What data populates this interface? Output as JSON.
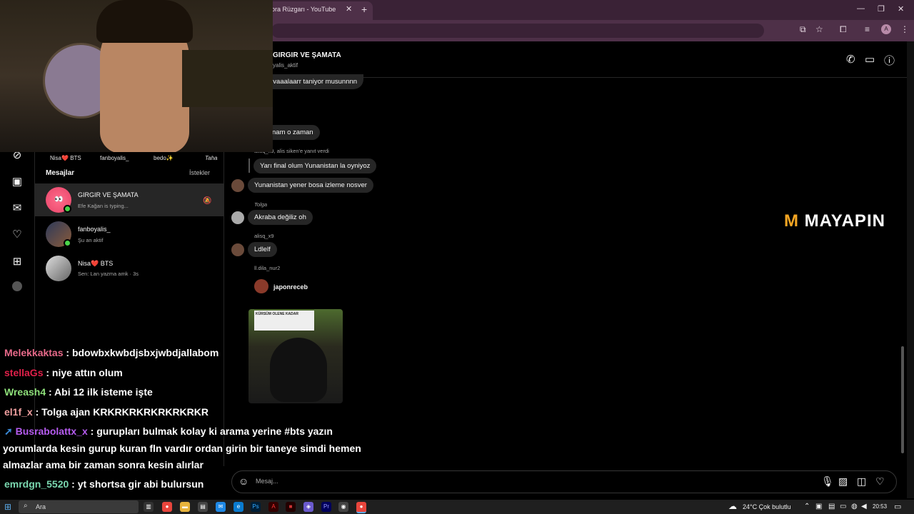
{
  "browser": {
    "tab_title": "ora Rüzgarı - YouTube",
    "tab_close": "✕",
    "new_tab": "+",
    "avatar_letter": "A"
  },
  "stories": [
    "Nisa❤️ BTS",
    "fanboyalis_",
    "bedo✨",
    "Taha"
  ],
  "dm": {
    "title": "Mesajlar",
    "requests": "İstekler",
    "conversations": [
      {
        "name": "GIRGIR VE ŞAMATA",
        "sub": "Efe Kağan is typing..."
      },
      {
        "name": "fanboyalis_",
        "sub": "Şu an aktif"
      },
      {
        "name": "Nisa❤️ BTS",
        "sub": "Sen: Lan yazma amk · 3s"
      }
    ]
  },
  "chat": {
    "title": "GIRGIR VE ŞAMATA",
    "subtitle": "yalis_aktif",
    "messages": [
      {
        "text": "ovaaalaarr taniyor musunnnn"
      },
      {
        "text": "nam o zaman"
      },
      {
        "reply_note": "alisq_x9, alis siken'e yanıt verdi",
        "text": "Yarı final olum Yunanistan la oyniyoz"
      },
      {
        "text": "Yunanistan yener bosa izleme nosver"
      },
      {
        "sender": "Tolga",
        "text": "Akraba değiliz oh"
      },
      {
        "sender": "alisq_x9",
        "text": "Ldlelf"
      },
      {
        "sender": "ll.dila_nur2",
        "text": "japonreceb"
      }
    ],
    "thumb_caption": "KÜRSÜM OLENE KADAR",
    "input_placeholder": "Mesaj..."
  },
  "watermark": {
    "m": "M",
    "rest": "MAYAPIN"
  },
  "twitch_chat": [
    {
      "user": "Melekkaktas",
      "color": "#e86a8a",
      "text": ": bdowbxkwbdjsbxjwbdjallabom"
    },
    {
      "user": "stellaGs",
      "color": "#e0204a",
      "text": ": niye attın olum"
    },
    {
      "user": "Wreash4",
      "color": "#8ee07a",
      "text": ": Abi 12 ilk isteme işte"
    },
    {
      "user": "el1f_x",
      "color": "#f0a0a0",
      "text": ": Tolga ajan KRKRKRKRKRKRKRKR"
    },
    {
      "user": "Busrabolattx_x",
      "color": "#b65cf0",
      "text": ": gurupları bulmak kolay ki arama yerine #bts yazın"
    },
    {
      "user": "",
      "color": "#ffffff",
      "text": "yorumlarda kesin gurup kuran fln vardır ordan girin bir taneye simdi hemen"
    },
    {
      "user": "",
      "color": "#ffffff",
      "text": "almazlar ama bir zaman sonra kesin alırlar"
    },
    {
      "user": "emrdgn_5520",
      "color": "#7ad8b0",
      "text": ": yt shortsa gir abi bulursun"
    }
  ],
  "taskbar": {
    "search": "Ara",
    "weather": "24°C  Çok bulutlu",
    "time": "20:53"
  }
}
